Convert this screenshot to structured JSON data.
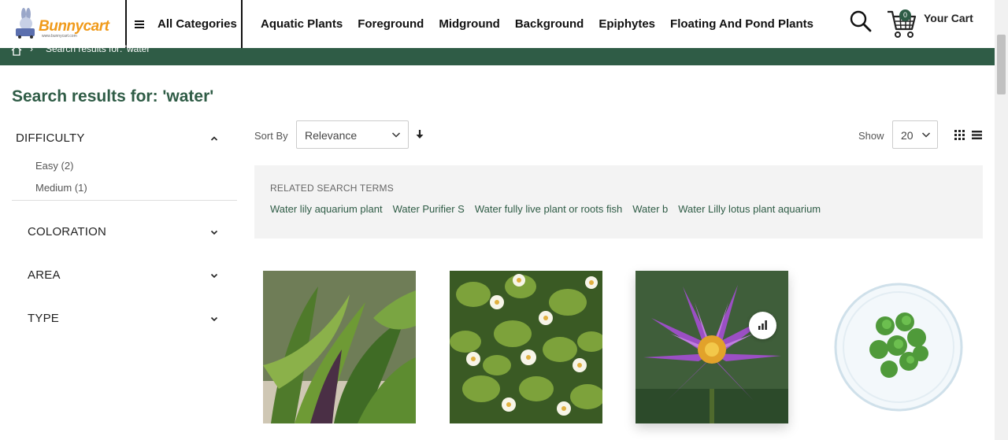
{
  "header": {
    "logo_text": "Bunnycart",
    "logo_sub": "www.bunnycart.com",
    "all_categories": "All Categories",
    "nav": [
      "Aquatic Plants",
      "Foreground",
      "Midground",
      "Background",
      "Epiphytes",
      "Floating And Pond Plants"
    ],
    "cart_count": "0",
    "cart_label": "Your Cart"
  },
  "breadcrumb": {
    "separator": "›",
    "current": "Search results for: 'water'"
  },
  "page_title": "Search results for: 'water'",
  "filters": {
    "difficulty": {
      "title": "DIFFICULTY",
      "options": [
        {
          "label": "Easy (2)"
        },
        {
          "label": "Medium (1)"
        }
      ]
    },
    "coloration": {
      "title": "COLORATION"
    },
    "area": {
      "title": "AREA"
    },
    "type": {
      "title": "TYPE"
    }
  },
  "toolbar": {
    "sort_label": "Sort By",
    "sort_value": "Relevance",
    "show_label": "Show",
    "show_value": "20"
  },
  "related": {
    "title": "RELATED SEARCH TERMS",
    "terms": [
      "Water lily aquarium plant",
      "Water Purifier S",
      "Water fully live plant or roots fish",
      "Water b",
      "Water Lilly lotus plant aquarium"
    ]
  },
  "colors": {
    "brand_green": "#2f5c46",
    "logo_orange": "#f09a1a"
  },
  "icons": [
    "home-icon",
    "search-icon",
    "cart-icon",
    "hamburger-icon",
    "chevron-up-icon",
    "chevron-down-icon",
    "sort-direction-icon",
    "grid-view-icon",
    "list-view-icon",
    "compare-icon"
  ]
}
